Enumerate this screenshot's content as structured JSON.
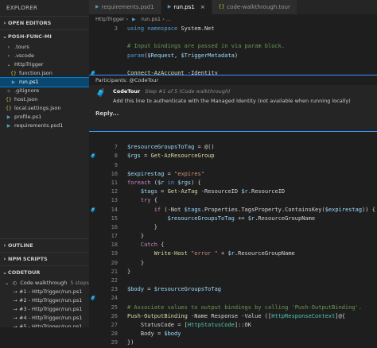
{
  "sidebar": {
    "header": "EXPLORER",
    "sections": {
      "open_editors": "OPEN EDITORS",
      "project": "POSH-FUNC-MI",
      "outline": "OUTLINE",
      "npm_scripts": "NPM SCRIPTS",
      "codetour": "CODETOUR"
    },
    "files": [
      {
        "label": ".tours",
        "icon": "chevron-right-icon",
        "indent": 1
      },
      {
        "label": ".vscode",
        "icon": "chevron-right-icon",
        "indent": 1
      },
      {
        "label": "HttpTrigger",
        "icon": "chevron-down-icon",
        "indent": 1
      },
      {
        "label": "function.json",
        "icon": "json-icon",
        "indent": 2
      },
      {
        "label": "run.ps1",
        "icon": "powershell-icon",
        "indent": 2,
        "selected": true
      },
      {
        "label": ".gitignore",
        "icon": "git-icon",
        "indent": 1
      },
      {
        "label": "host.json",
        "icon": "json-icon",
        "indent": 1
      },
      {
        "label": "local.settings.json",
        "icon": "json-icon",
        "indent": 1
      },
      {
        "label": "profile.ps1",
        "icon": "powershell-icon",
        "indent": 1
      },
      {
        "label": "requirements.psd1",
        "icon": "powershell-icon",
        "indent": 1
      }
    ],
    "tour": {
      "label": "Code walkthrough",
      "steps": "5 steps"
    },
    "tour_steps": [
      "#1 - HttpTrigger/run.ps1",
      "#2 - HttpTrigger/run.ps1",
      "#3 - HttpTrigger/run.ps1",
      "#4 - HttpTrigger/run.ps1",
      "#5 - HttpTrigger/run.ps1"
    ]
  },
  "tabs": [
    {
      "label": "requirements.psd1",
      "icon": "powershell-icon",
      "active": false
    },
    {
      "label": "run.ps1",
      "icon": "powershell-icon",
      "active": true
    },
    {
      "label": "code-walkthrough.tour",
      "icon": "json-icon",
      "active": false
    }
  ],
  "breadcrumb": [
    "HttpTrigger",
    "run.ps1",
    "..."
  ],
  "code_top": [
    {
      "n": "3",
      "gut": "",
      "html": "<span class='kw'>using</span> <span class='kw'>namespace</span> <span class='pl'>System.Net</span>"
    },
    {
      "n": "",
      "gut": "",
      "html": ""
    },
    {
      "n": "",
      "gut": "",
      "html": "<span class='cm'># Input bindings are passed in via param block.</span>"
    },
    {
      "n": "",
      "gut": "",
      "html": "<span class='kw'>param</span><span class='pl'>(</span><span class='var'>$Request</span><span class='pl'>, </span><span class='var'>$TriggerMetadata</span><span class='pl'>)</span>"
    },
    {
      "n": "",
      "gut": "",
      "html": ""
    },
    {
      "n": "",
      "gut": "tour",
      "html": "<span class='fn'>Connect-AzAccount</span> <span class='pl'>-Identity</span>"
    }
  ],
  "codetour": {
    "participants": "Participants: @CodeTour",
    "author": "CodeTour",
    "step": "Step #1 of 5 (Code walkthrough)",
    "text": "Add this line to authenticate with the Managed Identity (not available when running locally)",
    "reply": "Reply..."
  },
  "code_bottom": [
    {
      "n": "",
      "gut": "",
      "html": ""
    },
    {
      "n": "7",
      "gut": "",
      "html": "<span class='var'>$resourceGroupsToTag</span> <span class='op'>=</span> <span class='pl'>@()</span>"
    },
    {
      "n": "8",
      "gut": "tour",
      "html": "<span class='var'>$rgs</span> <span class='op'>=</span> <span class='fn'>Get-AzResourceGroup</span>"
    },
    {
      "n": "9",
      "gut": "",
      "html": ""
    },
    {
      "n": "10",
      "gut": "",
      "html": "<span class='var'>$expirestag</span> <span class='op'>=</span> <span class='str'>\"expires\"</span>"
    },
    {
      "n": "11",
      "gut": "",
      "html": "<span class='ctrl'>foreach</span> <span class='pl'>(</span><span class='var'>$r</span> <span class='kw'>in</span> <span class='var'>$rgs</span><span class='pl'>) {</span>"
    },
    {
      "n": "12",
      "gut": "",
      "html": "    <span class='var'>$tags</span> <span class='op'>=</span> <span class='fn'>Get-AzTag</span> <span class='pl'>-ResourceID</span> <span class='var'>$r</span><span class='pl'>.ResourceID</span>"
    },
    {
      "n": "13",
      "gut": "",
      "html": "    <span class='ctrl'>try</span> <span class='pl'>{</span>"
    },
    {
      "n": "14",
      "gut": "tour",
      "html": "        <span class='ctrl'>if</span> <span class='pl'>(-Not</span> <span class='var'>$tags</span><span class='pl'>.Properties.TagsProperty.ContainsKey(</span><span class='var'>$expirestag</span><span class='pl'>)) {</span>"
    },
    {
      "n": "15",
      "gut": "",
      "html": "            <span class='var'>$resourceGroupsToTag</span> <span class='op'>+=</span> <span class='var'>$r</span><span class='pl'>.ResourceGroupName</span>"
    },
    {
      "n": "16",
      "gut": "",
      "html": "        <span class='pl'>}</span>"
    },
    {
      "n": "17",
      "gut": "",
      "html": "    <span class='pl'>}</span>"
    },
    {
      "n": "18",
      "gut": "",
      "html": "    <span class='ctrl'>Catch</span> <span class='pl'>{</span>"
    },
    {
      "n": "19",
      "gut": "",
      "html": "        <span class='fn'>Write-Host</span> <span class='str'>\"error \"</span> <span class='op'>+</span> <span class='var'>$r</span><span class='pl'>.ResourceGroupName</span>"
    },
    {
      "n": "20",
      "gut": "",
      "html": "    <span class='pl'>}</span>"
    },
    {
      "n": "21",
      "gut": "",
      "html": "<span class='pl'>}</span>"
    },
    {
      "n": "22",
      "gut": "",
      "html": ""
    },
    {
      "n": "23",
      "gut": "",
      "html": "<span class='var'>$body</span> <span class='op'>=</span> <span class='var'>$resourceGroupsToTag</span>"
    },
    {
      "n": "24",
      "gut": "tour",
      "html": ""
    },
    {
      "n": "25",
      "gut": "",
      "html": "<span class='cm'># Associate values to output bindings by calling 'Push-OutputBinding'.</span>"
    },
    {
      "n": "26",
      "gut": "",
      "html": "<span class='fn'>Push-OutputBinding</span> <span class='pl'>-Name Response -Value ([</span><span class='ty'>HttpResponseContext</span><span class='pl'>]@{</span>"
    },
    {
      "n": "27",
      "gut": "",
      "html": "    <span class='pl'>StatusCode</span> <span class='op'>=</span> <span class='pl'>[</span><span class='ty'>HttpStatusCode</span><span class='pl'>]::OK</span>"
    },
    {
      "n": "28",
      "gut": "",
      "html": "    <span class='pl'>Body</span> <span class='op'>=</span> <span class='var'>$body</span>"
    },
    {
      "n": "29",
      "gut": "",
      "html": "<span class='pl'>})</span>"
    }
  ]
}
